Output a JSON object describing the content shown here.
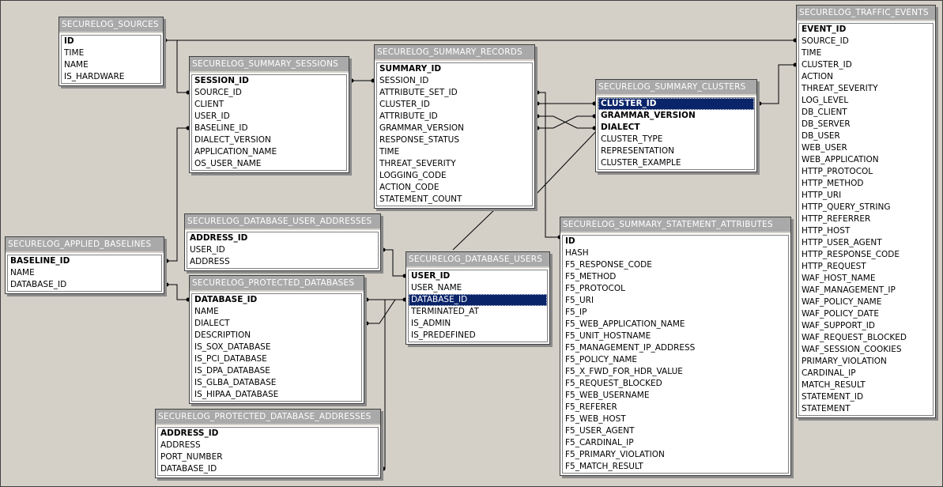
{
  "tables": {
    "sources": {
      "title": "SECURELOG_SOURCES",
      "rows": [
        {
          "label": "ID",
          "pk": true
        },
        {
          "label": "TIME"
        },
        {
          "label": "NAME"
        },
        {
          "label": "IS_HARDWARE"
        }
      ]
    },
    "sessions": {
      "title": "SECURELOG_SUMMARY_SESSIONS",
      "rows": [
        {
          "label": "SESSION_ID",
          "pk": true
        },
        {
          "label": "SOURCE_ID"
        },
        {
          "label": "CLIENT"
        },
        {
          "label": "USER_ID"
        },
        {
          "label": "BASELINE_ID"
        },
        {
          "label": "DIALECT_VERSION"
        },
        {
          "label": "APPLICATION_NAME"
        },
        {
          "label": "OS_USER_NAME"
        }
      ]
    },
    "records": {
      "title": "SECURELOG_SUMMARY_RECORDS",
      "rows": [
        {
          "label": "SUMMARY_ID",
          "pk": true
        },
        {
          "label": "SESSION_ID"
        },
        {
          "label": "ATTRIBUTE_SET_ID"
        },
        {
          "label": "CLUSTER_ID"
        },
        {
          "label": "ATTRIBUTE_ID"
        },
        {
          "label": "GRAMMAR_VERSION"
        },
        {
          "label": "RESPONSE_STATUS"
        },
        {
          "label": "TIME"
        },
        {
          "label": "THREAT_SEVERITY"
        },
        {
          "label": "LOGGING_CODE"
        },
        {
          "label": "ACTION_CODE"
        },
        {
          "label": "STATEMENT_COUNT"
        }
      ]
    },
    "clusters": {
      "title": "SECURELOG_SUMMARY_CLUSTERS",
      "rows": [
        {
          "label": "CLUSTER_ID",
          "pk": true,
          "sel": true
        },
        {
          "label": "GRAMMAR_VERSION",
          "pk": true
        },
        {
          "label": "DIALECT",
          "pk": true
        },
        {
          "label": "CLUSTER_TYPE"
        },
        {
          "label": "REPRESENTATION"
        },
        {
          "label": "CLUSTER_EXAMPLE"
        }
      ]
    },
    "traffic": {
      "title": "SECURELOG_TRAFFIC_EVENTS",
      "rows": [
        {
          "label": "EVENT_ID",
          "pk": true
        },
        {
          "label": "SOURCE_ID"
        },
        {
          "label": "TIME"
        },
        {
          "label": "CLUSTER_ID"
        },
        {
          "label": "ACTION"
        },
        {
          "label": "THREAT_SEVERITY"
        },
        {
          "label": "LOG_LEVEL"
        },
        {
          "label": "DB_CLIENT"
        },
        {
          "label": "DB_SERVER"
        },
        {
          "label": "DB_USER"
        },
        {
          "label": "WEB_USER"
        },
        {
          "label": "WEB_APPLICATION"
        },
        {
          "label": "HTTP_PROTOCOL"
        },
        {
          "label": "HTTP_METHOD"
        },
        {
          "label": "HTTP_URI"
        },
        {
          "label": "HTTP_QUERY_STRING"
        },
        {
          "label": "HTTP_REFERRER"
        },
        {
          "label": "HTTP_HOST"
        },
        {
          "label": "HTTP_USER_AGENT"
        },
        {
          "label": "HTTP_RESPONSE_CODE"
        },
        {
          "label": "HTTP_REQUEST"
        },
        {
          "label": "WAF_HOST_NAME"
        },
        {
          "label": "WAF_MANAGEMENT_IP"
        },
        {
          "label": "WAF_POLICY_NAME"
        },
        {
          "label": "WAF_POLICY_DATE"
        },
        {
          "label": "WAF_SUPPORT_ID"
        },
        {
          "label": "WAF_REQUEST_BLOCKED"
        },
        {
          "label": "WAF_SESSION_COOKIES"
        },
        {
          "label": "PRIMARY_VIOLATION"
        },
        {
          "label": "CARDINAL_IP"
        },
        {
          "label": "MATCH_RESULT"
        },
        {
          "label": "STATEMENT_ID"
        },
        {
          "label": "STATEMENT"
        }
      ]
    },
    "user_addresses": {
      "title": "SECURELOG_DATABASE_USER_ADDRESSES",
      "rows": [
        {
          "label": "ADDRESS_ID",
          "pk": true
        },
        {
          "label": "USER_ID"
        },
        {
          "label": "ADDRESS"
        }
      ]
    },
    "baselines": {
      "title": "SECURELOG_APPLIED_BASELINES",
      "rows": [
        {
          "label": "BASELINE_ID",
          "pk": true
        },
        {
          "label": "NAME"
        },
        {
          "label": "DATABASE_ID"
        }
      ]
    },
    "db_users": {
      "title": "SECURELOG_DATABASE_USERS",
      "rows": [
        {
          "label": "USER_ID",
          "pk": true
        },
        {
          "label": "USER_NAME"
        },
        {
          "label": "DATABASE_ID",
          "sel": true
        },
        {
          "label": "TERMINATED_AT"
        },
        {
          "label": "IS_ADMIN"
        },
        {
          "label": "IS_PREDEFINED"
        }
      ]
    },
    "protected_dbs": {
      "title": "SECURELOG_PROTECTED_DATABASES",
      "rows": [
        {
          "label": "DATABASE_ID",
          "pk": true
        },
        {
          "label": "NAME"
        },
        {
          "label": "DIALECT"
        },
        {
          "label": "DESCRIPTION"
        },
        {
          "label": "IS_SOX_DATABASE"
        },
        {
          "label": "IS_PCI_DATABASE"
        },
        {
          "label": "IS_DPA_DATABASE"
        },
        {
          "label": "IS_GLBA_DATABASE"
        },
        {
          "label": "IS_HIPAA_DATABASE"
        }
      ]
    },
    "statement_attrs": {
      "title": "SECURELOG_SUMMARY_STATEMENT_ATTRIBUTES",
      "rows": [
        {
          "label": "ID",
          "pk": true
        },
        {
          "label": "HASH"
        },
        {
          "label": "F5_RESPONSE_CODE"
        },
        {
          "label": "F5_METHOD"
        },
        {
          "label": "F5_PROTOCOL"
        },
        {
          "label": "F5_URI"
        },
        {
          "label": "F5_IP"
        },
        {
          "label": "F5_WEB_APPLICATION_NAME"
        },
        {
          "label": "F5_UNIT_HOSTNAME"
        },
        {
          "label": "F5_MANAGEMENT_IP_ADDRESS"
        },
        {
          "label": "F5_POLICY_NAME"
        },
        {
          "label": "F5_X_FWD_FOR_HDR_VALUE"
        },
        {
          "label": "F5_REQUEST_BLOCKED"
        },
        {
          "label": "F5_WEB_USERNAME"
        },
        {
          "label": "F5_REFERER"
        },
        {
          "label": "F5_WEB_HOST"
        },
        {
          "label": "F5_USER_AGENT"
        },
        {
          "label": "F5_CARDINAL_IP"
        },
        {
          "label": "F5_PRIMARY_VIOLATION"
        },
        {
          "label": "F5_MATCH_RESULT"
        }
      ]
    },
    "db_addresses": {
      "title": "SECURELOG_PROTECTED_DATABASE_ADDRESSES",
      "rows": [
        {
          "label": "ADDRESS_ID",
          "pk": true
        },
        {
          "label": "ADDRESS"
        },
        {
          "label": "PORT_NUMBER"
        },
        {
          "label": "DATABASE_ID"
        }
      ]
    }
  }
}
